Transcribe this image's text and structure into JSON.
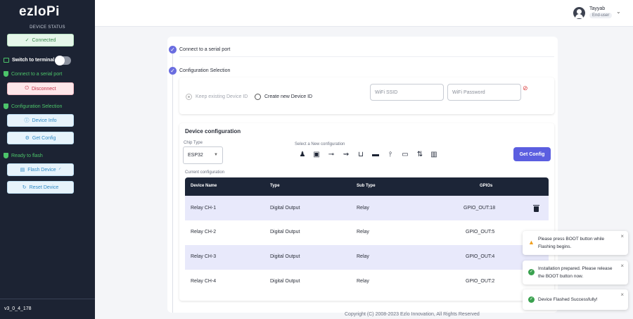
{
  "sidebar": {
    "logo": "ezloPi",
    "device_status_label": "DEVICE STATUS",
    "connected_label": "Connected",
    "switch_terminal_label": "Switch to terminal",
    "connect_serial_heading": "Connect to a serial port",
    "disconnect_label": "Disconnect",
    "config_selection_heading": "Configuration Selection",
    "device_info_label": "Device Info",
    "get_config_label": "Get Config",
    "ready_flash_heading": "Ready to flash",
    "flash_device_label": "Flash Device",
    "reset_device_label": "Reset Device",
    "version": "v3_0_4_178"
  },
  "header": {
    "user_name": "Tayyab",
    "user_role": "End-user"
  },
  "steps": {
    "step1": "Connect to a serial port",
    "step2": "Configuration Selection"
  },
  "wifi": {
    "keep_existing_label": "Keep existing Device ID",
    "create_new_label": "Create new Device ID",
    "ssid_placeholder": "WiFi SSID",
    "password_placeholder": "WiFi Password"
  },
  "device_config": {
    "title": "Device configuration",
    "chip_type_label": "Chip Type",
    "chip_type_value": "ESP32",
    "select_new_label": "Select a New configuration",
    "get_config_button": "Get Config",
    "current_config_label": "Current configuration",
    "icons": [
      "led-icon",
      "door-sensor-icon",
      "switch-icon",
      "digital-input-icon",
      "relay-icon",
      "pwm-icon",
      "antenna-icon",
      "lcd-icon",
      "uart-icon",
      "other-icon"
    ],
    "columns": [
      "Device Name",
      "Type",
      "Sub Type",
      "GPIOs"
    ],
    "rows": [
      {
        "name": "Relay CH-1",
        "type": "Digital Output",
        "sub_type": "Relay",
        "gpios": "GPIO_OUT:18"
      },
      {
        "name": "Relay CH-2",
        "type": "Digital Output",
        "sub_type": "Relay",
        "gpios": "GPIO_OUT:5"
      },
      {
        "name": "Relay CH-3",
        "type": "Digital Output",
        "sub_type": "Relay",
        "gpios": "GPIO_OUT:4"
      },
      {
        "name": "Relay CH-4",
        "type": "Digital Output",
        "sub_type": "Relay",
        "gpios": "GPIO_OUT:2"
      }
    ]
  },
  "footer": "Copyright (C) 2008-2023 Ezlo Innovation, All Rights Reserved",
  "toasts": [
    {
      "text": "Please press BOOT button while Flashing begins.",
      "kind": "warning"
    },
    {
      "text": "Installation prepared. Please release the BOOT button now.",
      "kind": "success"
    },
    {
      "text": "Device Flashed Successfully!",
      "kind": "success"
    }
  ],
  "colors": {
    "sidebar_bg": "#1c2333",
    "accent": "#5b5ee0",
    "table_header": "#1c2537",
    "row_highlight": "#e8e9fb"
  }
}
